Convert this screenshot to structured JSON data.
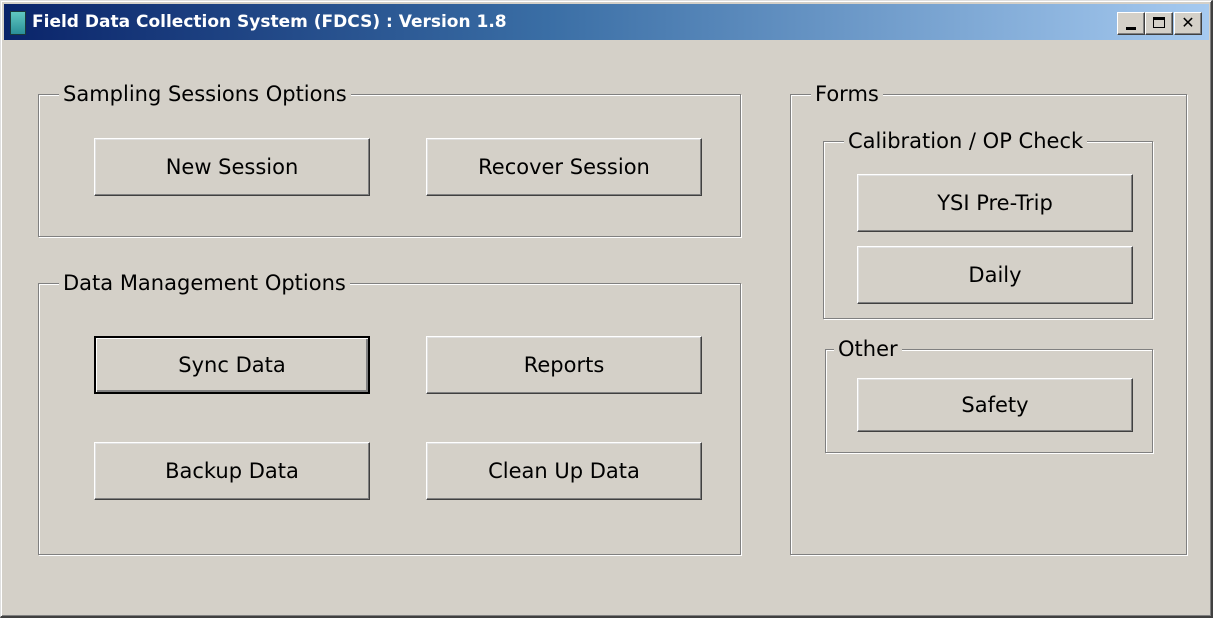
{
  "window": {
    "title": "Field Data Collection System (FDCS) : Version 1.8",
    "controls": {
      "minimize": "_",
      "maximize": "□",
      "close": "✕"
    }
  },
  "sampling": {
    "legend": "Sampling Sessions Options",
    "new_session": "New Session",
    "recover_session": "Recover Session"
  },
  "data_management": {
    "legend": "Data Management Options",
    "sync": "Sync Data",
    "reports": "Reports",
    "backup": "Backup Data",
    "cleanup": "Clean Up Data"
  },
  "forms": {
    "legend": "Forms",
    "calibration": {
      "legend": "Calibration / OP Check",
      "ysi": "YSI Pre-Trip",
      "daily": "Daily"
    },
    "other": {
      "legend": "Other",
      "safety": "Safety"
    }
  },
  "colors": {
    "face": "#d4d0c8",
    "title_start": "#0a246a",
    "title_end": "#a6caf0"
  }
}
